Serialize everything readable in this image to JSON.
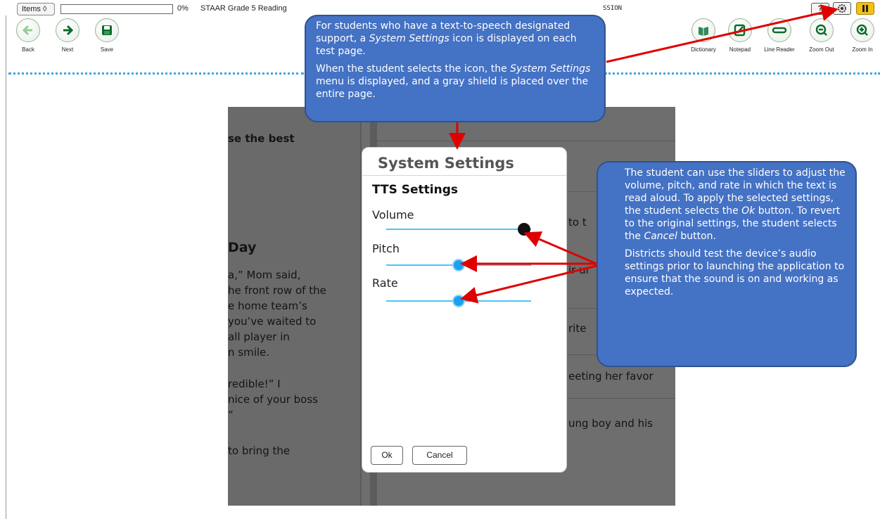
{
  "toolbar": {
    "items_label": "Items ◊",
    "progress_pct": "0%",
    "progress_value": 0,
    "test_title": "STAAR Grade 5 Reading",
    "session_tail": "SSION",
    "help_label": "?",
    "pause_label": "II"
  },
  "tools": {
    "back": "Back",
    "next": "Next",
    "save": "Save",
    "dictionary": "Dictionary",
    "notepad": "Notepad",
    "line_reader": "Line Reader",
    "zoom_out": "Zoom Out",
    "zoom_in": "Zoom In"
  },
  "passage": {
    "instruction": "se the best",
    "title": "Day",
    "lines": [
      "a,” Mom said,",
      "he front row of the",
      "e home team’s",
      "you’ve waited to",
      "all player in",
      "n smile.",
      "redible!” I",
      "nice of your boss",
      "”",
      "to bring the"
    ],
    "right_fragments": [
      "to t",
      "ir ur",
      "rite",
      "eeting her favor",
      "ung boy and his"
    ]
  },
  "dialog": {
    "title": "System Settings",
    "section": "TTS Settings",
    "volume_label": "Volume",
    "pitch_label": "Pitch",
    "rate_label": "Rate",
    "volume_level": 0.95,
    "pitch_level": 0.5,
    "rate_level": 0.5,
    "ok": "Ok",
    "cancel": "Cancel"
  },
  "callouts": {
    "top_p1_a": "For students who have a text-to-speech designated support, a ",
    "top_p1_em": "System Settings",
    "top_p1_b": " icon is displayed on each test page.",
    "top_p2_a": "When the student selects the icon, the ",
    "top_p2_em": "System Settings",
    "top_p2_b": " menu is displayed, and a gray shield is placed over the entire page.",
    "right_p1_a": "The student can use the sliders to adjust the volume, pitch, and rate in which the text is read aloud. To apply the selected settings, the student selects the ",
    "right_p1_em1": "Ok",
    "right_p1_b": " button. To revert to the original settings, the student selects the ",
    "right_p1_em2": "Cancel",
    "right_p1_c": " button.",
    "right_p2": "Districts should test the device’s audio settings prior to launching the application to ensure that the sound is on and working as expected."
  },
  "colors": {
    "callout_fill": "#4472c4",
    "arrow": "#e00000",
    "slider": "#4fc3f7",
    "pause": "#f3c017"
  }
}
